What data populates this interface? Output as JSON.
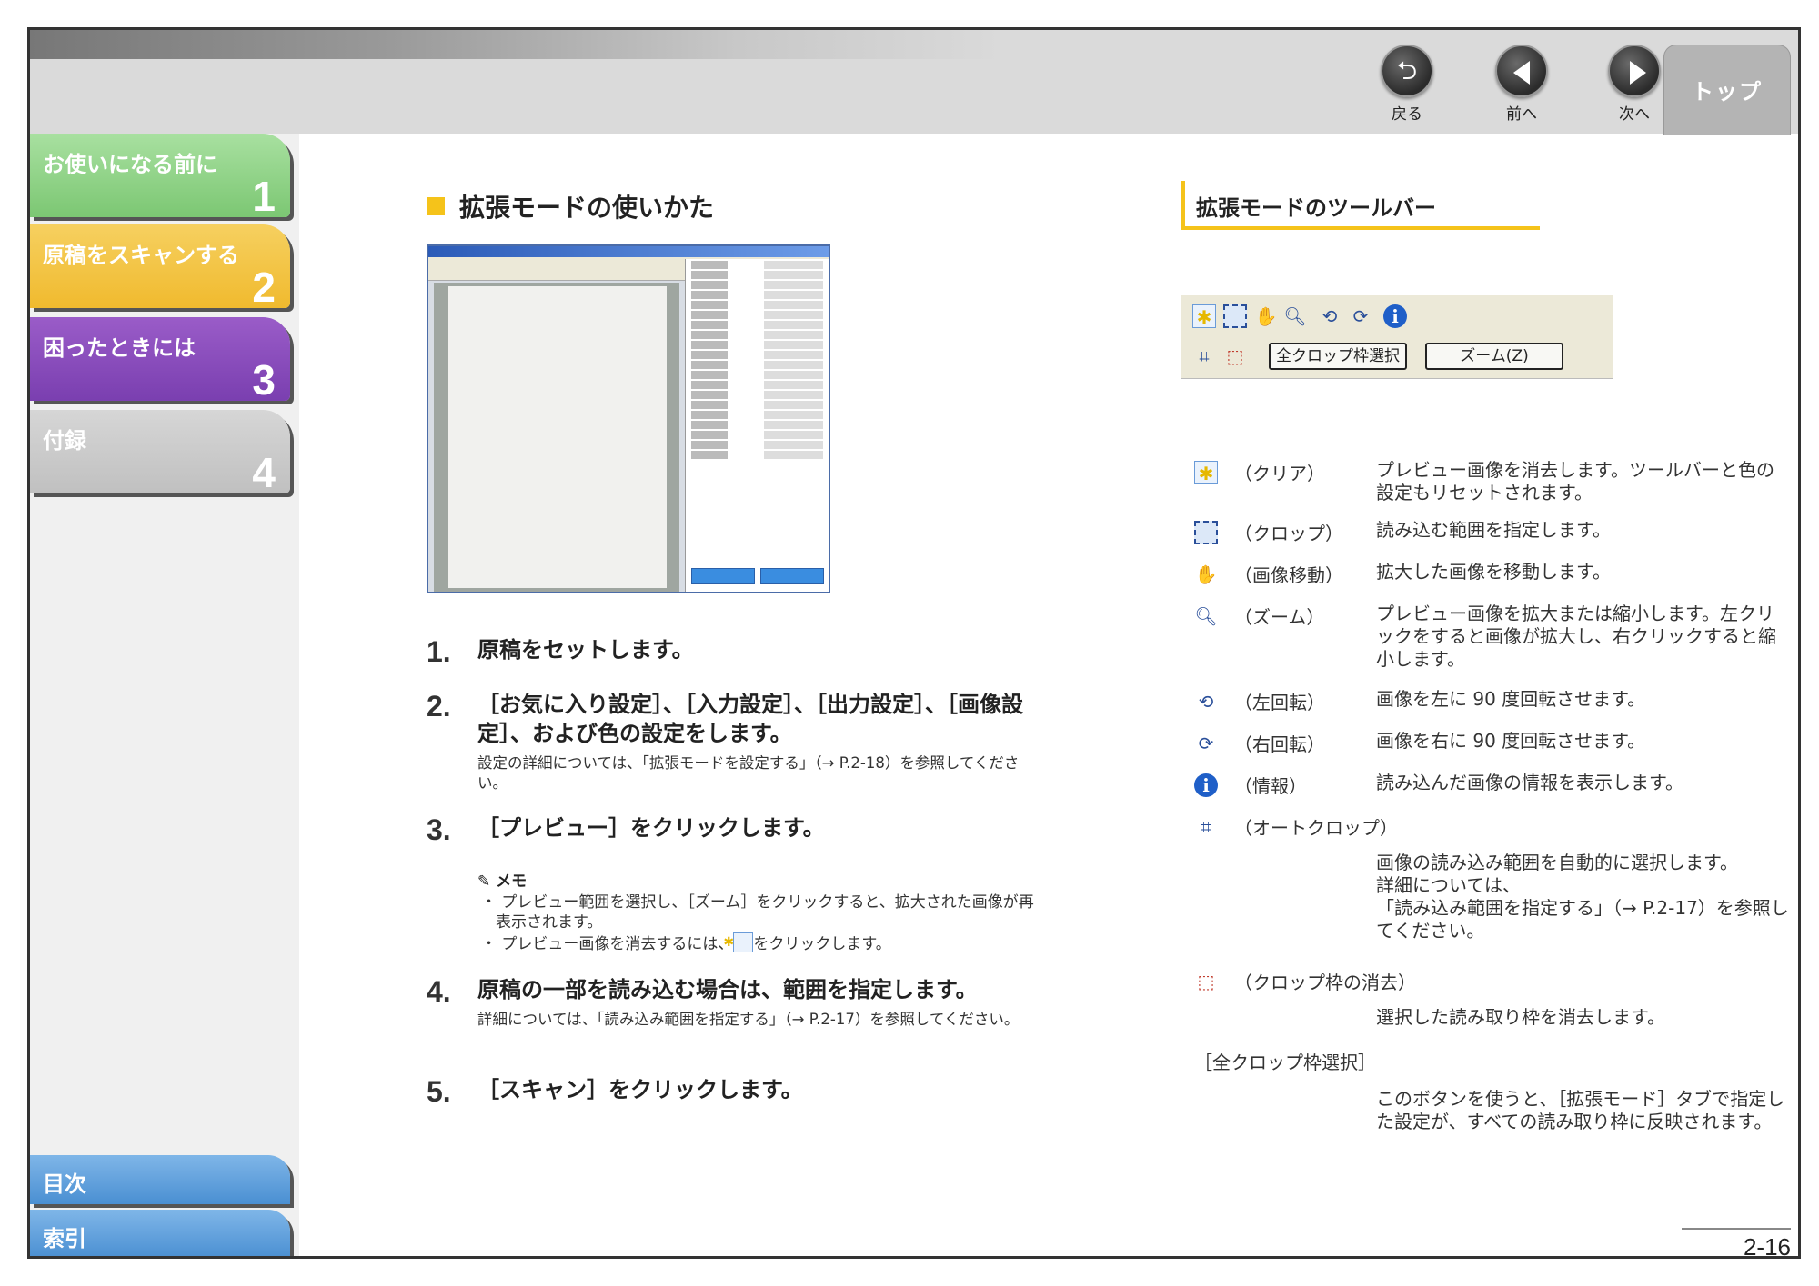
{
  "header": {
    "nav": {
      "back_label": "戻る",
      "prev_label": "前へ",
      "next_label": "次へ"
    },
    "top_tab": "トップ"
  },
  "sidebar": {
    "chapters": [
      {
        "title": "お使いになる前に",
        "number": "1",
        "color": "#7cc773"
      },
      {
        "title": "原稿をスキャンする",
        "number": "2",
        "color": "#f0ba2e"
      },
      {
        "title": "困ったときには",
        "number": "3",
        "color": "#7a3fb0"
      },
      {
        "title": "付録",
        "number": "4",
        "color": "#c0c0c0"
      }
    ],
    "toc_label": "目次",
    "index_label": "索引"
  },
  "main": {
    "section_title": "拡張モードの使いかた",
    "steps": [
      {
        "num": "1.",
        "head": "原稿をセットします。",
        "sub": ""
      },
      {
        "num": "2.",
        "head": "［お気に入り設定］、［入力設定］、［出力設定］、［画像設定］、および色の設定をします。",
        "sub": "設定の詳細については、「拡張モードを設定する」（→ P.2-18）を参照してください。"
      },
      {
        "num": "3.",
        "head": "［プレビュー］をクリックします。",
        "sub": ""
      },
      {
        "num": "4.",
        "head": "原稿の一部を読み込む場合は、範囲を指定します。",
        "sub": "詳細については、「読み込み範囲を指定する」（→ P.2-17）を参照してください。"
      },
      {
        "num": "5.",
        "head": "［スキャン］をクリックします。",
        "sub": ""
      }
    ],
    "memo": {
      "title": "メモ",
      "item1": "・ プレビュー範囲を選択し、［ズーム］をクリックすると、拡大された画像が再表示されます。",
      "item2a": "・ プレビュー画像を消去するには、",
      "item2b": "をクリックします。"
    }
  },
  "right": {
    "title": "拡張モードのツールバー",
    "toolbar": {
      "all_crop_btn": "全クロップ枠選択",
      "zoom_btn": "ズーム(Z)"
    },
    "items": [
      {
        "name": "（クリア）",
        "desc": "プレビュー画像を消去します。ツールバーと色の設定もリセットされます。",
        "icon": "clear-icon"
      },
      {
        "name": "（クロップ）",
        "desc": "読み込む範囲を指定します。",
        "icon": "crop-icon"
      },
      {
        "name": "（画像移動）",
        "desc": "拡大した画像を移動します。",
        "icon": "move-image-icon"
      },
      {
        "name": "（ズーム）",
        "desc": "プレビュー画像を拡大または縮小します。左クリックをすると画像が拡大し、右クリックすると縮小します。",
        "icon": "zoom-icon"
      },
      {
        "name": "（左回転）",
        "desc": "画像を左に 90 度回転させます。",
        "icon": "rotate-left-icon"
      },
      {
        "name": "（右回転）",
        "desc": "画像を右に 90 度回転させます。",
        "icon": "rotate-right-icon"
      },
      {
        "name": "（情報）",
        "desc": "読み込んだ画像の情報を表示します。",
        "icon": "info-icon"
      }
    ],
    "autocrop": {
      "name": "（オートクロップ）",
      "desc1": "画像の読み込み範囲を自動的に選択します。",
      "desc2": "詳細については、",
      "desc3": "「読み込み範囲を指定する」（→ P.2-17）を参照してください。"
    },
    "delete_crop": {
      "name": "（クロップ枠の消去）",
      "desc": "選択した読み取り枠を消去します。"
    },
    "all_crop": {
      "name": "［全クロップ枠選択］",
      "desc": "このボタンを使うと、［拡張モード］タブで指定した設定が、すべての読み取り枠に反映されます。"
    }
  },
  "page_number": "2-16"
}
